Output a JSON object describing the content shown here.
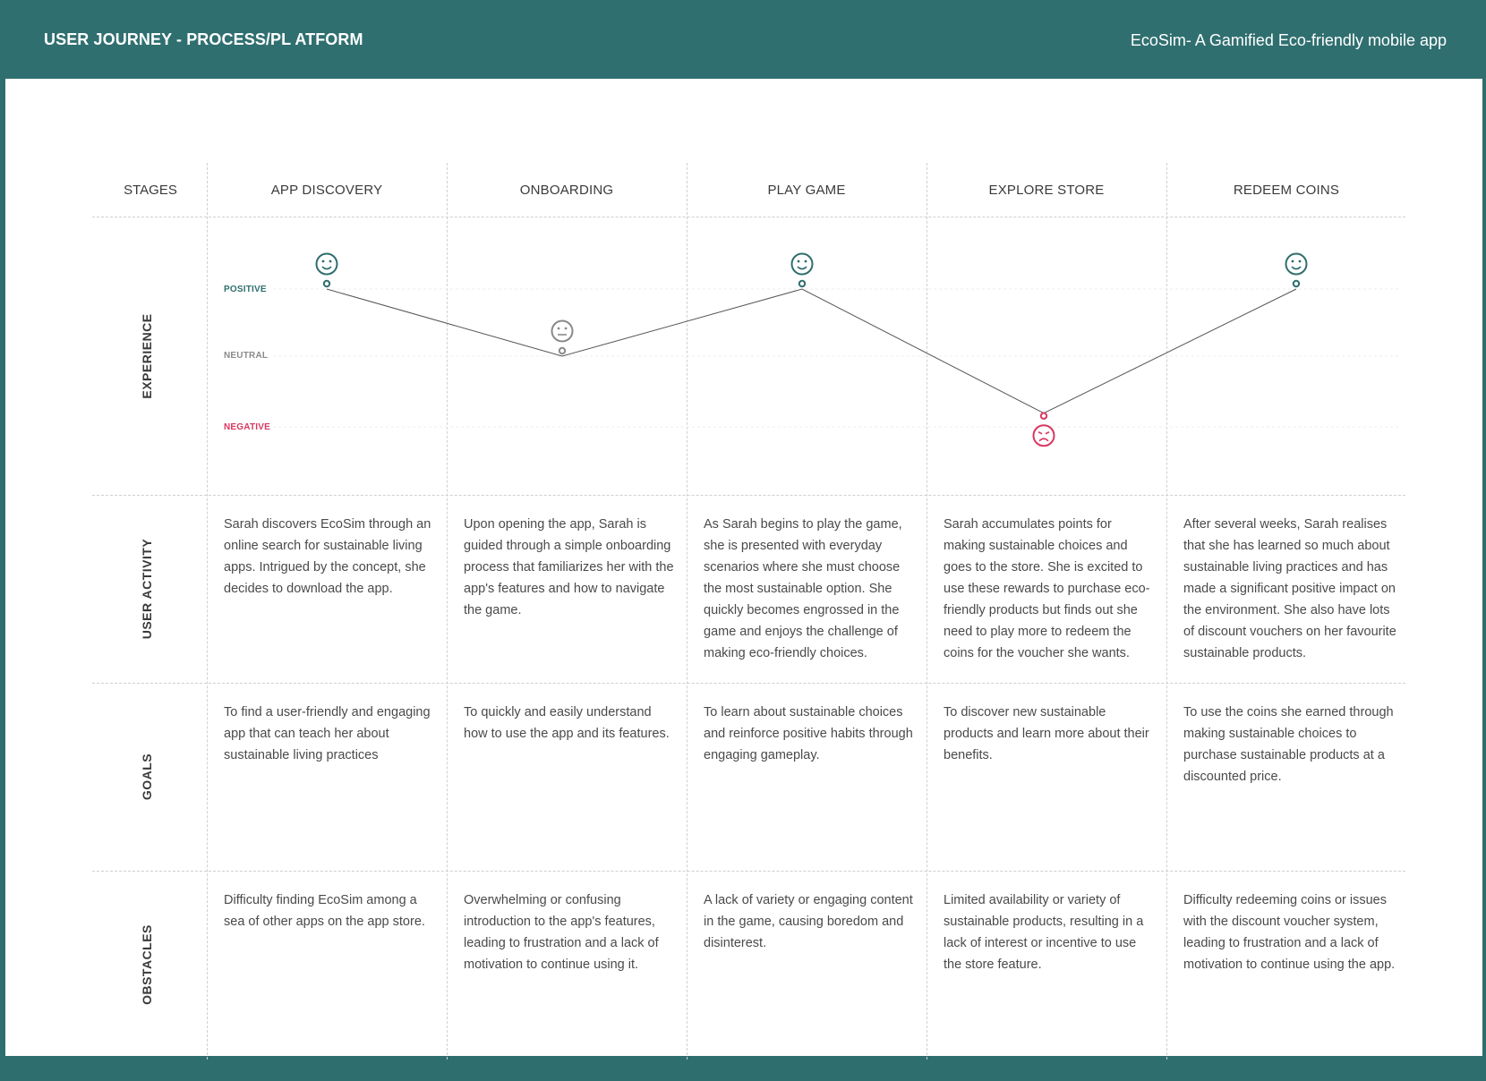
{
  "header": {
    "left_title": "USER JOURNEY - PROCESS/PL ATFORM",
    "right_title": "EcoSim- A Gamified Eco-friendly mobile app"
  },
  "stages_label": "STAGES",
  "stages": [
    "APP DISCOVERY",
    "ONBOARDING",
    "PLAY GAME",
    "EXPLORE STORE",
    "REDEEM COINS"
  ],
  "row_labels": {
    "experience": "EXPERIENCE",
    "user_activity": "USER ACTIVITY",
    "goals": "GOALS",
    "obstacles": "OBSTACLES"
  },
  "experience_levels": {
    "positive": "POSITIVE",
    "neutral": "NEUTRAL",
    "negative": "NEGATIVE"
  },
  "experience": [
    {
      "stage": "APP DISCOVERY",
      "emotion": "positive",
      "level": 1.0,
      "icon": "happy-face-icon"
    },
    {
      "stage": "ONBOARDING",
      "emotion": "neutral",
      "level": 0.0,
      "icon": "neutral-face-icon"
    },
    {
      "stage": "PLAY GAME",
      "emotion": "positive",
      "level": 1.0,
      "icon": "happy-face-icon"
    },
    {
      "stage": "EXPLORE STORE",
      "emotion": "negative",
      "level": -0.85,
      "icon": "sad-face-icon"
    },
    {
      "stage": "REDEEM COINS",
      "emotion": "positive",
      "level": 1.0,
      "icon": "happy-face-icon"
    }
  ],
  "colors": {
    "positive": "#2f6e6f",
    "neutral": "#8a8a8a",
    "negative": "#d8385f",
    "header": "#306f70"
  },
  "user_activity": [
    "Sarah discovers EcoSim through an online search for sustainable living apps. Intrigued by the concept, she decides to download the app.",
    "Upon opening the app, Sarah is guided through a simple onboarding process that familiarizes her with the app's features and how to navigate the game.",
    "As Sarah begins to play the game, she is presented with everyday scenarios where she must choose the most sustainable option. She quickly becomes engrossed in the game and enjoys the challenge of making eco-friendly choices.",
    "Sarah accumulates points for making sustainable choices and goes to the store. She is excited to use these rewards to purchase eco-friendly products but finds out she need to play more to redeem the coins for the voucher she wants.",
    "After several weeks, Sarah realises that she has learned so much about sustainable living practices and has made a significant positive impact on the environment. She also have lots of discount vouchers on her favourite sustainable products."
  ],
  "goals": [
    "To find a user-friendly and engaging app that can teach her about sustainable living practices",
    "To quickly and easily understand how to use the app and its features.",
    "To learn about sustainable choices and reinforce positive habits through engaging gameplay.",
    "To discover new sustainable products and learn more about their benefits.",
    "To use the coins she earned through making sustainable choices to purchase sustainable products at a discounted price."
  ],
  "obstacles": [
    "Difficulty finding EcoSim among a sea of other apps on the app store.",
    "Overwhelming or confusing introduction to the app's features, leading to frustration and a lack of motivation to continue using it.",
    "A lack of variety or engaging content in the game, causing boredom and disinterest.",
    " Limited availability or variety of sustainable products, resulting in a lack of interest or incentive to use the store feature.",
    "Difficulty redeeming coins or issues with the discount voucher system, leading to frustration and a lack of motivation to continue using the app."
  ]
}
